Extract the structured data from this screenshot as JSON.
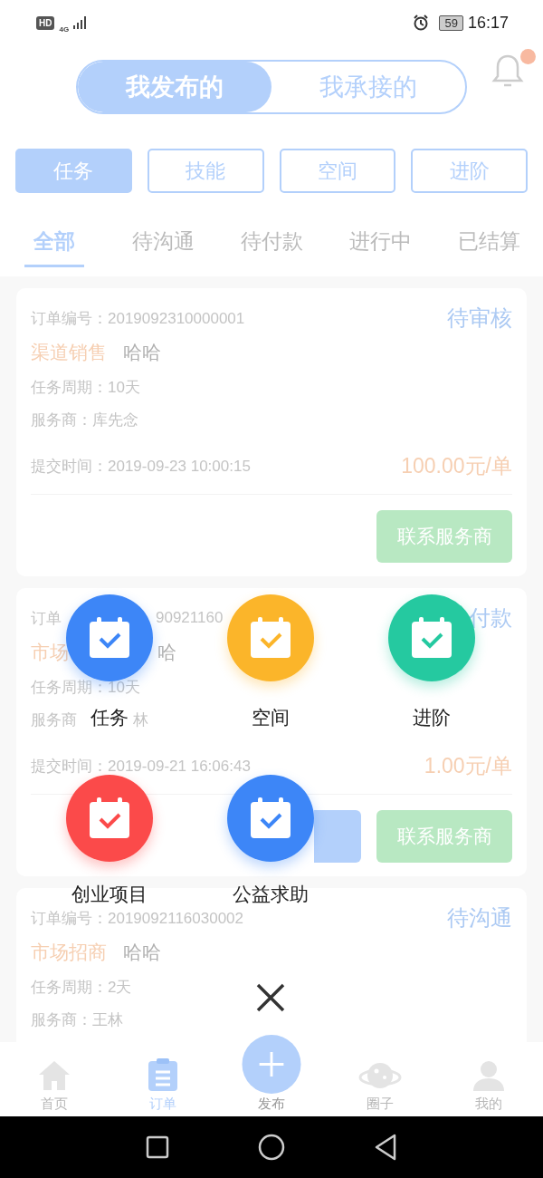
{
  "status_bar": {
    "hd": "HD",
    "network": "4G",
    "battery": "59",
    "time": "16:17"
  },
  "toggle": [
    {
      "label": "我发布的",
      "selected": true
    },
    {
      "label": "我承接的",
      "selected": false
    }
  ],
  "bell": {
    "unread": true
  },
  "categories": [
    {
      "label": "任务",
      "selected": true
    },
    {
      "label": "技能",
      "selected": false
    },
    {
      "label": "空间",
      "selected": false
    },
    {
      "label": "进阶",
      "selected": false
    }
  ],
  "tabs": [
    {
      "label": "全部",
      "selected": true
    },
    {
      "label": "待沟通",
      "selected": false
    },
    {
      "label": "待付款",
      "selected": false
    },
    {
      "label": "进行中",
      "selected": false
    },
    {
      "label": "已结算",
      "selected": false
    }
  ],
  "orders": [
    {
      "order": [
        "订单编号：2019092310000001"
      ],
      "status": "待审核",
      "category": "渠道销售",
      "name": "哈哈",
      "period": "任务周期：10天",
      "provider": [
        "服务商：库先念"
      ],
      "time": "提交时间：2019-09-23 10:00:15",
      "price": "100.00元/单",
      "buttons": [
        {
          "kind": "green",
          "label": "联系服务商"
        }
      ]
    },
    {
      "kind": "partial",
      "order": [
        "订单",
        "90921160"
      ],
      "status": "付款",
      "category": "市场",
      "name": "哈",
      "period": "任务周期：10天",
      "provider": [
        "服务商",
        "林"
      ],
      "time": "提交时间：2019-09-21 16:06:43",
      "price": "1.00元/单",
      "buttons": [
        {
          "kind": "blue"
        },
        {
          "kind": "green",
          "label": "联系服务商"
        }
      ]
    },
    {
      "order": [
        "订单编号：2019092116030002"
      ],
      "status": "待沟通",
      "category": "市场招商",
      "name": "哈哈",
      "period": "任务周期：2天",
      "provider": [
        "服务商：王林"
      ]
    }
  ],
  "publish_menu": [
    {
      "label": "任务",
      "color": "#3d86f7"
    },
    {
      "label": "空间",
      "color": "#fbb52a"
    },
    {
      "label": "进阶",
      "color": "#25c9a0"
    },
    {
      "label": "创业项目",
      "color": "#fb4a4a"
    },
    {
      "label": "公益求助",
      "color": "#3d86f7"
    }
  ],
  "bottom_nav": [
    {
      "label": "首页",
      "kind": "home",
      "selected": false
    },
    {
      "label": "订单",
      "kind": "orders",
      "selected": true
    },
    {
      "label": "发布",
      "kind": "publish",
      "selected": false
    },
    {
      "label": "圈子",
      "kind": "planet",
      "selected": false
    },
    {
      "label": "我的",
      "kind": "profile",
      "selected": false
    }
  ]
}
